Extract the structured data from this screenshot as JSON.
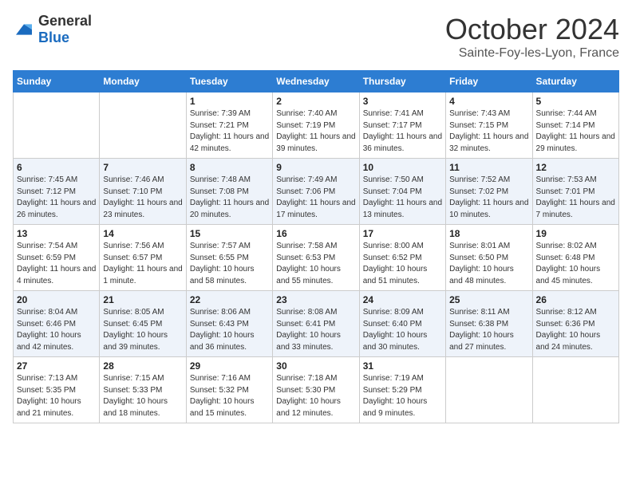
{
  "logo": {
    "general": "General",
    "blue": "Blue"
  },
  "title": {
    "month": "October 2024",
    "location": "Sainte-Foy-les-Lyon, France"
  },
  "days_of_week": [
    "Sunday",
    "Monday",
    "Tuesday",
    "Wednesday",
    "Thursday",
    "Friday",
    "Saturday"
  ],
  "weeks": [
    [
      {
        "day": "",
        "sunrise": "",
        "sunset": "",
        "daylight": ""
      },
      {
        "day": "",
        "sunrise": "",
        "sunset": "",
        "daylight": ""
      },
      {
        "day": "1",
        "sunrise": "Sunrise: 7:39 AM",
        "sunset": "Sunset: 7:21 PM",
        "daylight": "Daylight: 11 hours and 42 minutes."
      },
      {
        "day": "2",
        "sunrise": "Sunrise: 7:40 AM",
        "sunset": "Sunset: 7:19 PM",
        "daylight": "Daylight: 11 hours and 39 minutes."
      },
      {
        "day": "3",
        "sunrise": "Sunrise: 7:41 AM",
        "sunset": "Sunset: 7:17 PM",
        "daylight": "Daylight: 11 hours and 36 minutes."
      },
      {
        "day": "4",
        "sunrise": "Sunrise: 7:43 AM",
        "sunset": "Sunset: 7:15 PM",
        "daylight": "Daylight: 11 hours and 32 minutes."
      },
      {
        "day": "5",
        "sunrise": "Sunrise: 7:44 AM",
        "sunset": "Sunset: 7:14 PM",
        "daylight": "Daylight: 11 hours and 29 minutes."
      }
    ],
    [
      {
        "day": "6",
        "sunrise": "Sunrise: 7:45 AM",
        "sunset": "Sunset: 7:12 PM",
        "daylight": "Daylight: 11 hours and 26 minutes."
      },
      {
        "day": "7",
        "sunrise": "Sunrise: 7:46 AM",
        "sunset": "Sunset: 7:10 PM",
        "daylight": "Daylight: 11 hours and 23 minutes."
      },
      {
        "day": "8",
        "sunrise": "Sunrise: 7:48 AM",
        "sunset": "Sunset: 7:08 PM",
        "daylight": "Daylight: 11 hours and 20 minutes."
      },
      {
        "day": "9",
        "sunrise": "Sunrise: 7:49 AM",
        "sunset": "Sunset: 7:06 PM",
        "daylight": "Daylight: 11 hours and 17 minutes."
      },
      {
        "day": "10",
        "sunrise": "Sunrise: 7:50 AM",
        "sunset": "Sunset: 7:04 PM",
        "daylight": "Daylight: 11 hours and 13 minutes."
      },
      {
        "day": "11",
        "sunrise": "Sunrise: 7:52 AM",
        "sunset": "Sunset: 7:02 PM",
        "daylight": "Daylight: 11 hours and 10 minutes."
      },
      {
        "day": "12",
        "sunrise": "Sunrise: 7:53 AM",
        "sunset": "Sunset: 7:01 PM",
        "daylight": "Daylight: 11 hours and 7 minutes."
      }
    ],
    [
      {
        "day": "13",
        "sunrise": "Sunrise: 7:54 AM",
        "sunset": "Sunset: 6:59 PM",
        "daylight": "Daylight: 11 hours and 4 minutes."
      },
      {
        "day": "14",
        "sunrise": "Sunrise: 7:56 AM",
        "sunset": "Sunset: 6:57 PM",
        "daylight": "Daylight: 11 hours and 1 minute."
      },
      {
        "day": "15",
        "sunrise": "Sunrise: 7:57 AM",
        "sunset": "Sunset: 6:55 PM",
        "daylight": "Daylight: 10 hours and 58 minutes."
      },
      {
        "day": "16",
        "sunrise": "Sunrise: 7:58 AM",
        "sunset": "Sunset: 6:53 PM",
        "daylight": "Daylight: 10 hours and 55 minutes."
      },
      {
        "day": "17",
        "sunrise": "Sunrise: 8:00 AM",
        "sunset": "Sunset: 6:52 PM",
        "daylight": "Daylight: 10 hours and 51 minutes."
      },
      {
        "day": "18",
        "sunrise": "Sunrise: 8:01 AM",
        "sunset": "Sunset: 6:50 PM",
        "daylight": "Daylight: 10 hours and 48 minutes."
      },
      {
        "day": "19",
        "sunrise": "Sunrise: 8:02 AM",
        "sunset": "Sunset: 6:48 PM",
        "daylight": "Daylight: 10 hours and 45 minutes."
      }
    ],
    [
      {
        "day": "20",
        "sunrise": "Sunrise: 8:04 AM",
        "sunset": "Sunset: 6:46 PM",
        "daylight": "Daylight: 10 hours and 42 minutes."
      },
      {
        "day": "21",
        "sunrise": "Sunrise: 8:05 AM",
        "sunset": "Sunset: 6:45 PM",
        "daylight": "Daylight: 10 hours and 39 minutes."
      },
      {
        "day": "22",
        "sunrise": "Sunrise: 8:06 AM",
        "sunset": "Sunset: 6:43 PM",
        "daylight": "Daylight: 10 hours and 36 minutes."
      },
      {
        "day": "23",
        "sunrise": "Sunrise: 8:08 AM",
        "sunset": "Sunset: 6:41 PM",
        "daylight": "Daylight: 10 hours and 33 minutes."
      },
      {
        "day": "24",
        "sunrise": "Sunrise: 8:09 AM",
        "sunset": "Sunset: 6:40 PM",
        "daylight": "Daylight: 10 hours and 30 minutes."
      },
      {
        "day": "25",
        "sunrise": "Sunrise: 8:11 AM",
        "sunset": "Sunset: 6:38 PM",
        "daylight": "Daylight: 10 hours and 27 minutes."
      },
      {
        "day": "26",
        "sunrise": "Sunrise: 8:12 AM",
        "sunset": "Sunset: 6:36 PM",
        "daylight": "Daylight: 10 hours and 24 minutes."
      }
    ],
    [
      {
        "day": "27",
        "sunrise": "Sunrise: 7:13 AM",
        "sunset": "Sunset: 5:35 PM",
        "daylight": "Daylight: 10 hours and 21 minutes."
      },
      {
        "day": "28",
        "sunrise": "Sunrise: 7:15 AM",
        "sunset": "Sunset: 5:33 PM",
        "daylight": "Daylight: 10 hours and 18 minutes."
      },
      {
        "day": "29",
        "sunrise": "Sunrise: 7:16 AM",
        "sunset": "Sunset: 5:32 PM",
        "daylight": "Daylight: 10 hours and 15 minutes."
      },
      {
        "day": "30",
        "sunrise": "Sunrise: 7:18 AM",
        "sunset": "Sunset: 5:30 PM",
        "daylight": "Daylight: 10 hours and 12 minutes."
      },
      {
        "day": "31",
        "sunrise": "Sunrise: 7:19 AM",
        "sunset": "Sunset: 5:29 PM",
        "daylight": "Daylight: 10 hours and 9 minutes."
      },
      {
        "day": "",
        "sunrise": "",
        "sunset": "",
        "daylight": ""
      },
      {
        "day": "",
        "sunrise": "",
        "sunset": "",
        "daylight": ""
      }
    ]
  ]
}
